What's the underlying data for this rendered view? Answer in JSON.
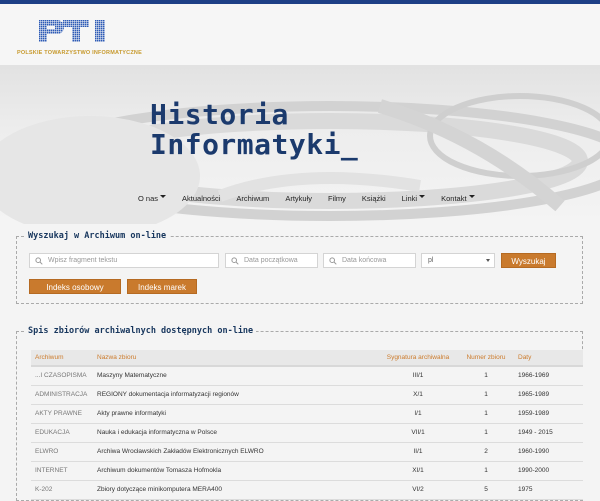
{
  "logo": {
    "mark": "PTI",
    "subtitle": "POLSKIE TOWARZYSTWO INFORMATYCZNE"
  },
  "hero": {
    "title_line1": "Historia",
    "title_line2": "Informatyki_"
  },
  "nav": [
    {
      "label": "O nas",
      "dropdown": true
    },
    {
      "label": "Aktualności",
      "dropdown": false
    },
    {
      "label": "Archiwum",
      "dropdown": false
    },
    {
      "label": "Artykuły",
      "dropdown": false
    },
    {
      "label": "Filmy",
      "dropdown": false
    },
    {
      "label": "Książki",
      "dropdown": false
    },
    {
      "label": "Linki",
      "dropdown": true
    },
    {
      "label": "Kontakt",
      "dropdown": true
    }
  ],
  "search": {
    "legend": "Wyszukaj w Archiwum on-line",
    "text_placeholder": "Wpisz fragment tekstu",
    "date_from_placeholder": "Data początkowa",
    "date_to_placeholder": "Data końcowa",
    "language_value": "pl",
    "submit_label": "Wyszukaj",
    "person_index_label": "Indeks osobowy",
    "brand_index_label": "Indeks marek"
  },
  "list": {
    "legend": "Spis zbiorów archiwalnych dostępnych on-line",
    "headers": [
      "Archiwum",
      "Nazwa zbioru",
      "Sygnatura archiwalna",
      "Numer zbioru",
      "Daty"
    ],
    "rows": [
      [
        "...I CZASOPISMA",
        "Maszyny Matematyczne",
        "III/1",
        "1",
        "1966-1969"
      ],
      [
        "ADMINISTRACJA",
        "REGIONY dokumentacja informatyzacji regionów",
        "X/1",
        "1",
        "1965-1989"
      ],
      [
        "AKTY PRAWNE",
        "Akty prawne informatyki",
        "I/1",
        "1",
        "1959-1989"
      ],
      [
        "EDUKACJA",
        "Nauka i edukacja informatyczna w Polsce",
        "VII/1",
        "1",
        "1949 - 2015"
      ],
      [
        "ELWRO",
        "Archiwa Wrocławskich Zakładów Elektronicznych ELWRO",
        "II/1",
        "2",
        "1960-1990"
      ],
      [
        "INTERNET",
        "Archiwum dokumentów Tomasza Hofmokla",
        "XI/1",
        "1",
        "1990-2000"
      ],
      [
        "K-202",
        "Zbiory dotyczące minikomputera MERA400",
        "VI/2",
        "5",
        "1975"
      ]
    ]
  }
}
